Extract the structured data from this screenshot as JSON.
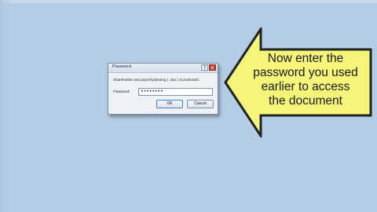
{
  "dialog": {
    "title": "Password",
    "help_glyph": "?",
    "close_glyph": "x",
    "prompt": "Shareholder and payroll planning ( .xlsx ) is protected:",
    "field_label": "Password:",
    "password_value": "••••••••",
    "ok_label": "OK",
    "cancel_label": "Cancel"
  },
  "callout": {
    "lines": [
      "Now enter the",
      "password you used",
      "earlier to access",
      "the document"
    ],
    "fill_color": "#f5f57a",
    "outline_color": "#222222"
  },
  "background_color": "#b3cde6"
}
